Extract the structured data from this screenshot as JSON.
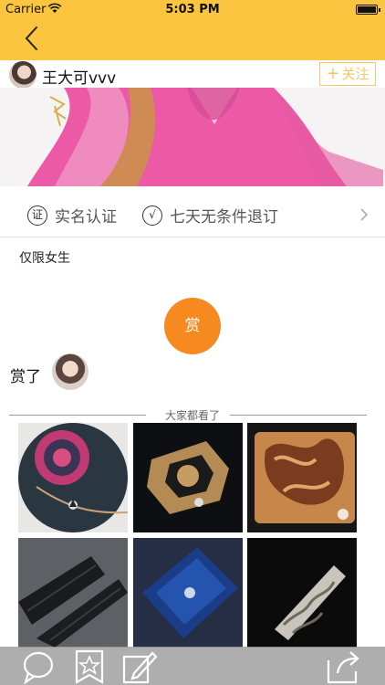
{
  "status_bar": {
    "carrier": "Carrier",
    "time": "5:03 PM"
  },
  "nav": {
    "back_icon": "chevron-left-icon"
  },
  "seller": {
    "name": "王大可vvv",
    "follow_label": "关注",
    "follow_prefix": "+"
  },
  "guarantees": [
    {
      "badge": "证",
      "label": "实名认证"
    },
    {
      "badge": "√",
      "label": "七天无条件退订"
    }
  ],
  "note": "仅限女生",
  "reward": {
    "button_label": "赏",
    "rewarded_label": "赏了"
  },
  "recommend": {
    "title": "大家都看了"
  },
  "colors": {
    "nav_yellow": "#fcc540",
    "reward_orange": "#f6891f",
    "follow_gold": "#f5c66a"
  },
  "bottom_bar": {
    "icons": [
      "comment-icon",
      "bookmark-star-icon",
      "edit-icon",
      "share-icon"
    ]
  }
}
